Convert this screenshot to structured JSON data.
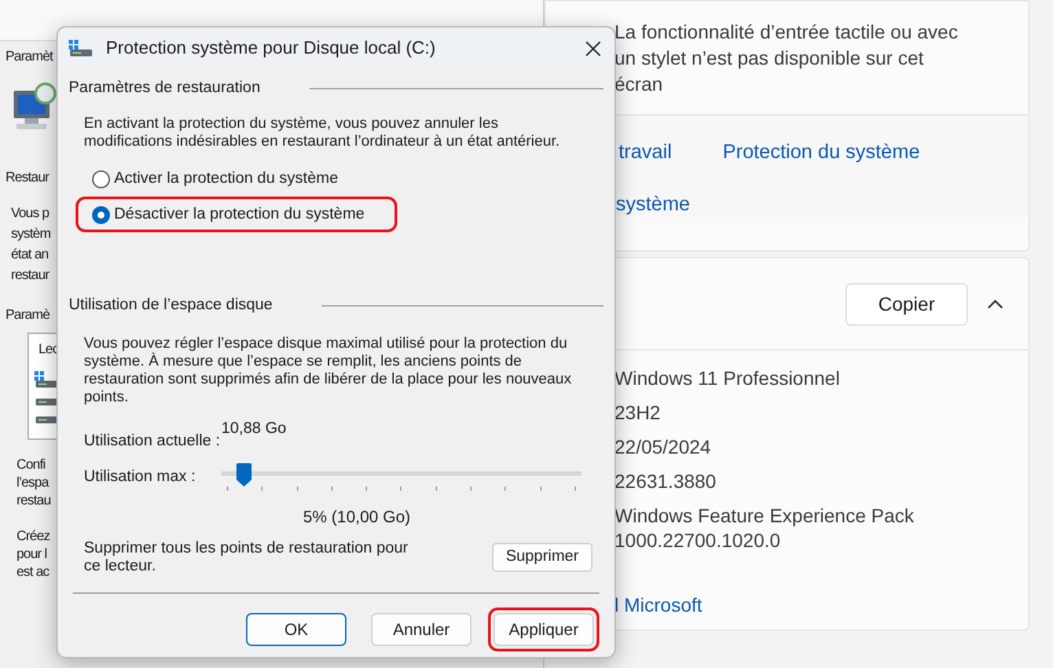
{
  "system_properties": {
    "tab_label": "Paramèt",
    "section_restore": "Restaur",
    "paragraph_1": [
      "Vous p",
      "systèm",
      "état an",
      "restaur"
    ],
    "section_settings": "Paramè",
    "drives_list": {
      "header": "Lec"
    },
    "paragraph_2": [
      "Confi",
      "l’espa",
      "restau"
    ],
    "paragraph_3": [
      "Créez",
      "pour l",
      "est ac"
    ]
  },
  "settings_window": {
    "touch_text": [
      "La fonctionnalité d’entrée tactile ou avec",
      "un stylet n’est pas disponible sur cet",
      "écran"
    ],
    "links_row_1": [
      "travail",
      "Protection du système"
    ],
    "links_row_2": "système",
    "specs_card": {
      "copy_button": "Copier",
      "expanded": true,
      "values": [
        "Windows 11 Professionnel",
        "23H2",
        "22/05/2024",
        "22631.3880",
        "Windows Feature Experience Pack\n1000.22700.1020.0"
      ],
      "link": "l Microsoft"
    }
  },
  "dialog": {
    "title": "Protection système pour Disque local (C:)",
    "restore_group": {
      "title": "Paramètres de restauration",
      "description": "En activant la protection du système, vous pouvez annuler les modifications indésirables en restaurant l’ordinateur à un état antérieur.",
      "options": [
        {
          "label": "Activer la protection du système",
          "selected": false,
          "highlighted": false
        },
        {
          "label": "Désactiver la protection du système",
          "selected": true,
          "highlighted": true
        }
      ]
    },
    "disk_group": {
      "title": "Utilisation de l’espace disque",
      "description": "Vous pouvez régler l’espace disque maximal utilisé pour la protection du système. À mesure que l’espace se remplit, les anciens points de restauration sont supprimés afin de libérer de la place pour les nouveaux points.",
      "current_label": "Utilisation actuelle :",
      "current_value": "10,88 Go",
      "max_label": "Utilisation max :",
      "max_slider": {
        "level": 0.06
      },
      "max_value": "5% (10,00 Go)",
      "delete_text": "Supprimer tous les points de restauration pour ce lecteur.",
      "delete_button": "Supprimer"
    },
    "buttons": [
      {
        "label": "OK",
        "default": true,
        "highlighted": false
      },
      {
        "label": "Annuler",
        "default": false,
        "highlighted": false
      },
      {
        "label": "Appliquer",
        "default": false,
        "highlighted": true
      }
    ]
  }
}
